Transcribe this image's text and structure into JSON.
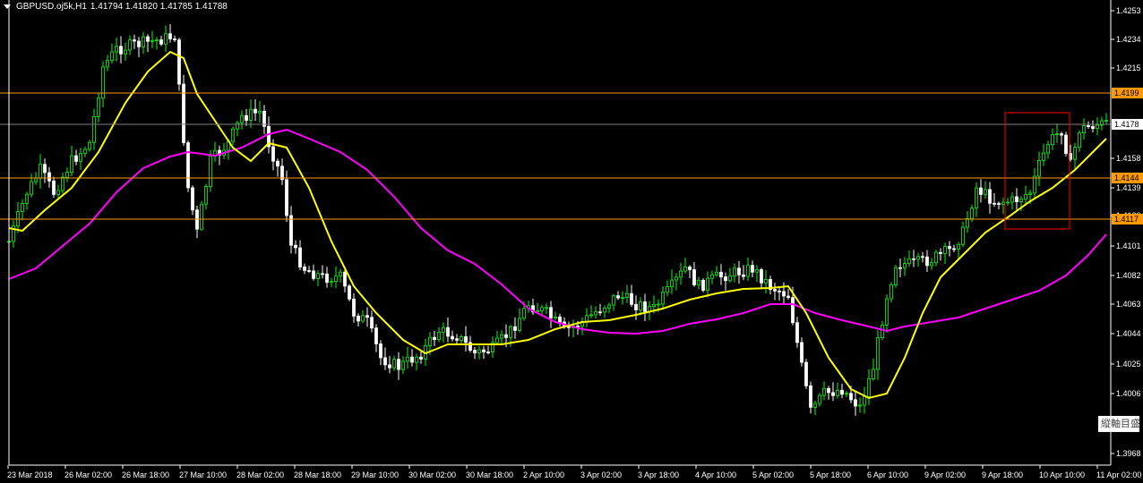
{
  "header": {
    "symbol_tf": "GBPUSD.oj5k,H1",
    "ohlc": "1.41794 1.41820 1.41785 1.41788"
  },
  "colors": {
    "background": "#000000",
    "bull_candle": "#00ff00",
    "bear_candle": "#ffffff",
    "ma_fast": "#ffff00",
    "ma_slow": "#ff00ff",
    "hline": "#ff9900",
    "price_line": "#808080",
    "highlight_box": "#ff0000"
  },
  "price_axis": {
    "ticks": [
      "1.4253",
      "1.4234",
      "1.4215",
      "1.4158",
      "1.4139",
      "1.4120",
      "1.4101",
      "1.4082",
      "1.4063",
      "1.4044",
      "1.4025",
      "1.4006",
      "1.3968"
    ],
    "tags": [
      {
        "label": "1.4199",
        "kind": "hline"
      },
      {
        "label": "1.4178",
        "kind": "current"
      },
      {
        "label": "1.4144",
        "kind": "hline"
      },
      {
        "label": "1.4117",
        "kind": "hline"
      }
    ]
  },
  "time_axis": {
    "labels": [
      "23 Mar 2018",
      "26 Mar 02:00",
      "26 Mar 18:00",
      "27 Mar 10:00",
      "28 Mar 02:00",
      "28 Mar 18:00",
      "29 Mar 10:00",
      "30 Mar 02:00",
      "30 Mar 18:00",
      "2 Apr 10:00",
      "3 Apr 02:00",
      "3 Apr 18:00",
      "4 Apr 10:00",
      "5 Apr 02:00",
      "5 Apr 18:00",
      "6 Apr 10:00",
      "9 Apr 02:00",
      "9 Apr 18:00",
      "10 Apr 10:00",
      "11 Apr 02:00"
    ]
  },
  "watermark": "縦軸目盛"
}
